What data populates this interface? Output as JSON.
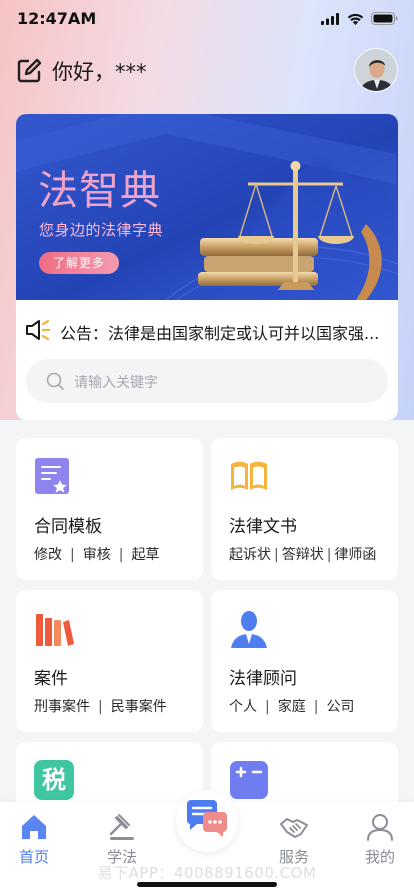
{
  "status_bar": {
    "time": "12:47AM"
  },
  "header": {
    "greeting": "你好，***"
  },
  "banner": {
    "title": "法智典",
    "subtitle": "您身边的法律字典",
    "button_label": "了解更多"
  },
  "notice": {
    "text": "公告：法律是由国家制定或认可并以国家强..."
  },
  "search": {
    "placeholder": "请输入关键字"
  },
  "services": [
    {
      "title": "合同模板",
      "items": [
        "修改",
        "审核",
        "起草"
      ]
    },
    {
      "title": "法律文书",
      "items": [
        "起诉状",
        "答辩状",
        "律师函"
      ]
    },
    {
      "title": "案件",
      "items": [
        "刑事案件",
        "民事案件"
      ]
    },
    {
      "title": "法律顾问",
      "items": [
        "个人",
        "家庭",
        "公司"
      ]
    },
    {
      "title": "",
      "icon_text": "税"
    },
    {
      "title": ""
    }
  ],
  "tabbar": {
    "tabs": [
      {
        "label": "首页"
      },
      {
        "label": "学法"
      },
      {
        "label": "服务"
      },
      {
        "label": "我的"
      }
    ]
  },
  "watermark": "易下APP：4008891600.COM",
  "colors": {
    "accent": "#4e7cf1",
    "banner_bg": "#2447b8",
    "tax_icon": "#3fc6a0"
  }
}
